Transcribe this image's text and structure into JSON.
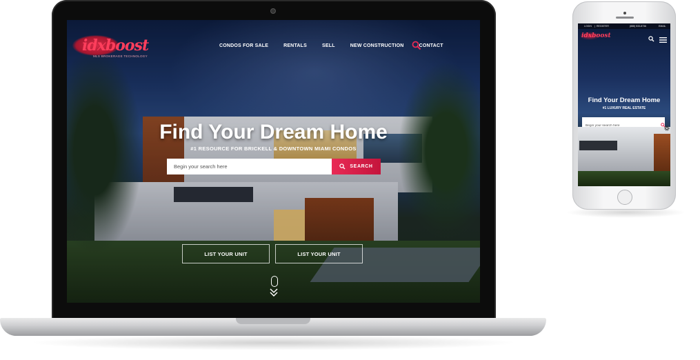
{
  "colors": {
    "accent": "#e92a55",
    "accent_dark": "#c4153c",
    "logo": "#ff3e5c",
    "text_light": "#ffffff"
  },
  "laptop": {
    "logo": {
      "text": "idxboost",
      "tagline": "MLS BROKERAGE TECHNOLOGY"
    },
    "nav": {
      "items": [
        {
          "label": "CONDOS FOR SALE"
        },
        {
          "label": "RENTALS"
        },
        {
          "label": "SELL"
        },
        {
          "label": "NEW CONSTRUCTION"
        },
        {
          "label": "CONTACT"
        }
      ],
      "search_icon": "search-icon"
    },
    "hero": {
      "title": "Find Your Dream Home",
      "subtitle": "#1 RESOURCE FOR BRICKELL & DOWNTOWN MIAMI CONDOS",
      "search_placeholder": "Begin your search here",
      "search_button": "SEARCH",
      "list_button_1": "LIST YOUR UNIT",
      "list_button_2": "LIST YOUR UNIT",
      "scroll_icon": "mouse-scroll-icon"
    }
  },
  "phone": {
    "topbar": {
      "login": "LOGIN",
      "separator": "|",
      "register": "REGISTER",
      "phone": "(888) 533-8736",
      "email": "EMAIL"
    },
    "logo": {
      "text": "idxboost"
    },
    "hero": {
      "title": "Find Your Dream Home",
      "subtitle": "#1 LUXURY REAL ESTATE",
      "search_placeholder": "Begin your search here"
    }
  }
}
